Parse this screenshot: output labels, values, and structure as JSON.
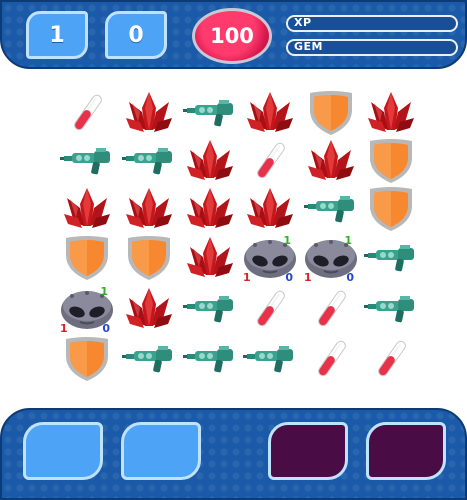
{
  "hud": {
    "counter_left": "1",
    "counter_right": "0",
    "score": "100",
    "xp_label": "XP",
    "gem_label": "GEM"
  },
  "colors": {
    "panel_blue": "#1a5aa8",
    "counter_blue": "#4da3f5",
    "score_red": "#e0194f",
    "slot_purple": "#4a0c44",
    "crystal_red": "#c4161c",
    "shield_orange": "#f7882f",
    "potion_red": "#e8324a"
  },
  "board": {
    "rows": [
      [
        {
          "piece": "potion-icon"
        },
        {
          "piece": "crystal-icon"
        },
        {
          "piece": "raygun-icon"
        },
        {
          "piece": "crystal-icon"
        },
        {
          "piece": "shield-icon"
        },
        {
          "piece": "crystal-icon"
        }
      ],
      [
        {
          "piece": "raygun-icon"
        },
        {
          "piece": "raygun-icon"
        },
        {
          "piece": "crystal-icon"
        },
        {
          "piece": "potion-icon"
        },
        {
          "piece": "crystal-icon"
        },
        {
          "piece": "shield-icon"
        }
      ],
      [
        {
          "piece": "crystal-icon"
        },
        {
          "piece": "crystal-icon"
        },
        {
          "piece": "crystal-icon"
        },
        {
          "piece": "crystal-icon"
        },
        {
          "piece": "raygun-icon"
        },
        {
          "piece": "shield-icon"
        }
      ],
      [
        {
          "piece": "shield-icon"
        },
        {
          "piece": "shield-icon"
        },
        {
          "piece": "crystal-icon"
        },
        {
          "piece": "alien-icon",
          "top_stat": "1",
          "left_stat": "1",
          "right_stat": "0"
        },
        {
          "piece": "alien-icon",
          "top_stat": "1",
          "left_stat": "1",
          "right_stat": "0"
        },
        {
          "piece": "raygun-icon"
        }
      ],
      [
        {
          "piece": "alien-icon",
          "top_stat": "1",
          "left_stat": "1",
          "right_stat": "0"
        },
        {
          "piece": "crystal-icon"
        },
        {
          "piece": "raygun-icon"
        },
        {
          "piece": "potion-icon"
        },
        {
          "piece": "potion-icon"
        },
        {
          "piece": "raygun-icon"
        }
      ],
      [
        {
          "piece": "shield-icon"
        },
        {
          "piece": "raygun-icon"
        },
        {
          "piece": "raygun-icon"
        },
        {
          "piece": "raygun-icon"
        },
        {
          "piece": "potion-icon"
        },
        {
          "piece": "potion-icon"
        }
      ]
    ]
  },
  "slots": [
    {
      "color": "blue"
    },
    {
      "color": "blue"
    },
    {
      "color": "purple"
    },
    {
      "color": "purple"
    }
  ]
}
